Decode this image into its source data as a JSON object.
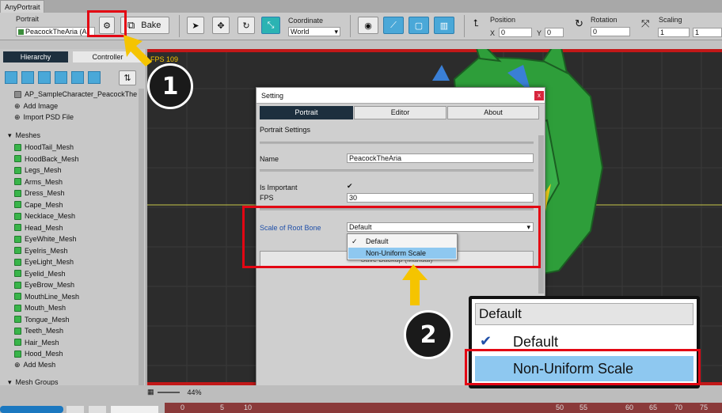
{
  "window": {
    "tab_title": "AnyPortrait"
  },
  "toolbar": {
    "portrait_label": "Portrait",
    "portrait_value": "PeacockTheAria (A",
    "bake_label": "Bake",
    "coordinate_label": "Coordinate",
    "coordinate_value": "World",
    "position_label": "Position",
    "pos_x_label": "X",
    "pos_x": "0",
    "pos_y_label": "Y",
    "pos_y": "0",
    "rotation_label": "Rotation",
    "rotation": "0",
    "scaling_label": "Scaling",
    "scale_x": "1",
    "scale_y": "1"
  },
  "left_panel": {
    "tab_hierarchy": "Hierarchy",
    "tab_controller": "Controller",
    "root": "AP_SampleCharacter_PeacockThe",
    "add_image": "Add Image",
    "import_psd": "Import PSD File",
    "meshes_header": "Meshes",
    "meshes": [
      "HoodTail_Mesh",
      "HoodBack_Mesh",
      "Legs_Mesh",
      "Arms_Mesh",
      "Dress_Mesh",
      "Cape_Mesh",
      "Necklace_Mesh",
      "Head_Mesh",
      "EyeWhite_Mesh",
      "EyeIris_Mesh",
      "EyeLight_Mesh",
      "Eyelid_Mesh",
      "EyeBrow_Mesh",
      "MouthLine_Mesh",
      "Mouth_Mesh",
      "Tongue_Mesh",
      "Teeth_Mesh",
      "Hair_Mesh",
      "Hood_Mesh"
    ],
    "add_mesh": "Add Mesh",
    "mesh_groups_header": "Mesh Groups"
  },
  "viewport": {
    "fps": "FPS 109",
    "zoom": "44%"
  },
  "dialog": {
    "title": "Setting",
    "close": "x",
    "tabs": [
      "Portrait",
      "Editor",
      "About"
    ],
    "section": "Portrait Settings",
    "name_label": "Name",
    "name_value": "PeacockTheAria",
    "important_label": "Is Important",
    "important_check": "✔",
    "fps_label": "FPS",
    "fps_value": "30",
    "scale_label": "Scale of Root Bone",
    "scale_value": "Default",
    "dropdown_options": [
      "Default",
      "Non-Uniform Scale"
    ],
    "backup_button": "Save Backup (Manual)"
  },
  "zoom_callout": {
    "header": "Default",
    "option1": "Default",
    "option2": "Non-Uniform Scale",
    "check": "✔"
  },
  "badges": {
    "one": "1",
    "two": "2"
  },
  "timeline": {
    "ticks": [
      "0",
      "5",
      "10",
      "50",
      "55",
      "60",
      "65",
      "70",
      "75"
    ]
  },
  "colors": {
    "accent": "#4aa8d8",
    "callout_red": "#e30613",
    "arrow_yellow": "#f5c400",
    "highlight": "#8ec8f0",
    "tab_active": "#1d2f3e"
  }
}
